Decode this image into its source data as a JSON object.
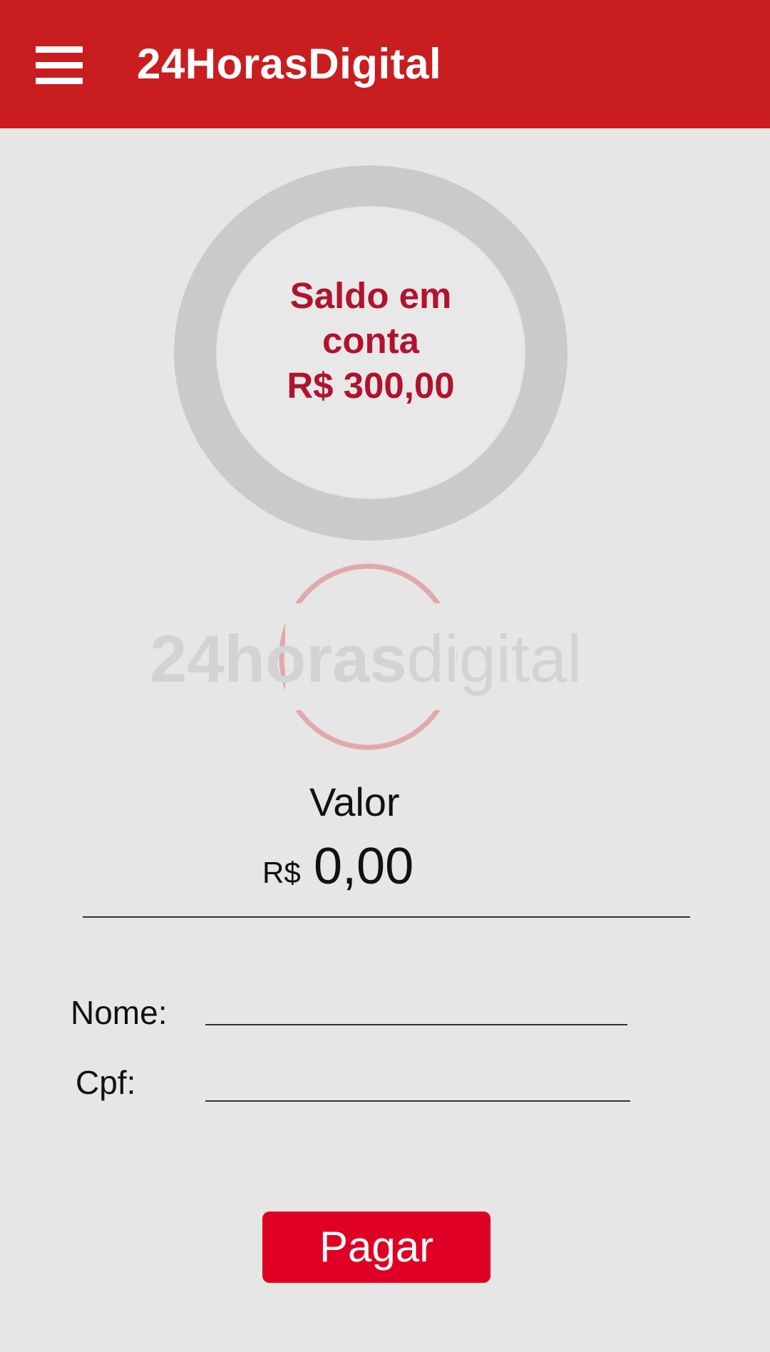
{
  "appbar": {
    "title": "24HorasDigital",
    "menu_icon": "hamburger-menu-icon",
    "background_color": "#c91d1f"
  },
  "balance": {
    "line1": "Saldo em",
    "line2": "conta",
    "amount": "R$ 300,00",
    "text_color": "#b0132f"
  },
  "logo": {
    "text_bold": "24horas",
    "text_light": "digital"
  },
  "payment": {
    "valor_label": "Valor",
    "currency_prefix": "R$",
    "amount": "0,00"
  },
  "form": {
    "nome_label": "Nome:",
    "nome_value": "",
    "cpf_label": "Cpf:",
    "cpf_value": ""
  },
  "actions": {
    "pay_label": "Pagar",
    "pay_color": "#e00025"
  }
}
